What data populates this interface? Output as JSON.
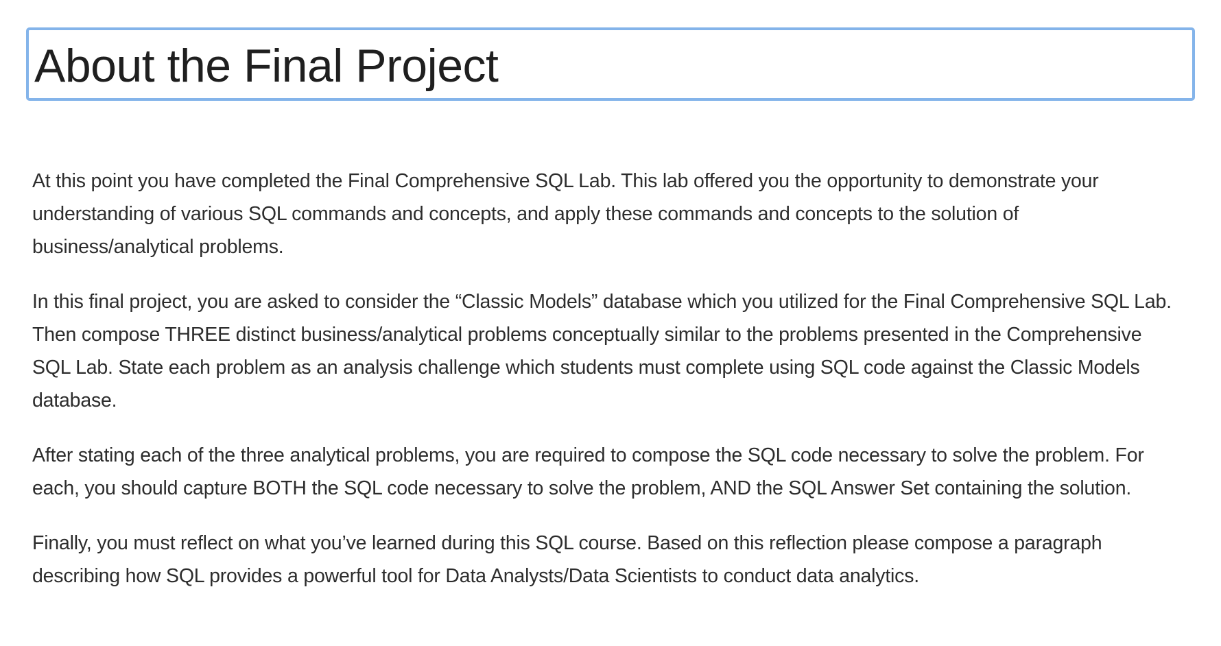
{
  "document": {
    "title": "About the Final Project",
    "paragraphs": [
      "At this point you have completed the Final Comprehensive SQL Lab.  This lab offered you the opportunity to demonstrate your understanding of various SQL commands and concepts, and apply these commands and concepts to the solution of business/analytical problems.",
      "In this final project, you are asked to consider the “Classic Models” database which you utilized for the Final Comprehensive SQL Lab.  Then compose THREE distinct business/analytical problems conceptually similar to the problems presented in the Comprehensive SQL Lab.  State each problem as an analysis challenge which students must complete using SQL code against the Classic Models database.",
      "After stating each of the three analytical problems, you are required to compose the SQL code necessary to solve the problem.  For each, you should capture BOTH the SQL code necessary to solve the problem, AND the SQL Answer Set containing the solution.",
      "Finally, you must reflect on what you’ve learned during this SQL course.  Based on this reflection please compose a paragraph describing how SQL provides a powerful tool for Data Analysts/Data Scientists to conduct data analytics."
    ]
  },
  "colors": {
    "title_border": "#84b4ea",
    "text": "#2d2d2d"
  }
}
